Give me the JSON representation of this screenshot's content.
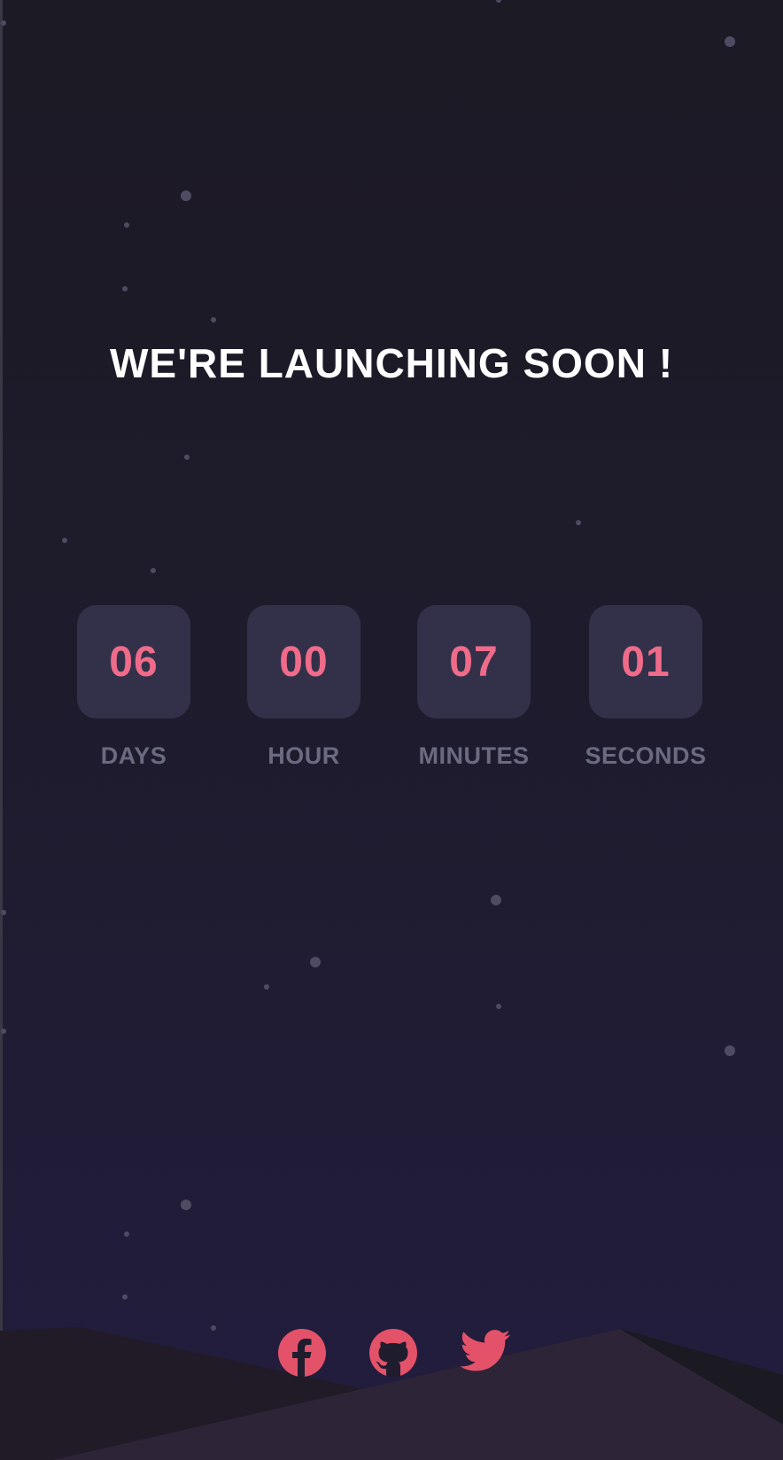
{
  "heading": "WE'RE LAUNCHING SOON !",
  "countdown": {
    "days": {
      "value": "06",
      "label": "DAYS"
    },
    "hours": {
      "value": "00",
      "label": "HOUR"
    },
    "minutes": {
      "value": "07",
      "label": "MINUTES"
    },
    "seconds": {
      "value": "01",
      "label": "SECONDS"
    }
  },
  "social": [
    {
      "name": "facebook",
      "icon": "facebook-icon"
    },
    {
      "name": "github",
      "icon": "github-icon"
    },
    {
      "name": "twitter",
      "icon": "twitter-icon"
    }
  ],
  "colors": {
    "accent": "#f06b8a",
    "icon": "#e4526a",
    "card": "#33314a",
    "label": "#6a6a80",
    "heading": "#ffffff"
  }
}
